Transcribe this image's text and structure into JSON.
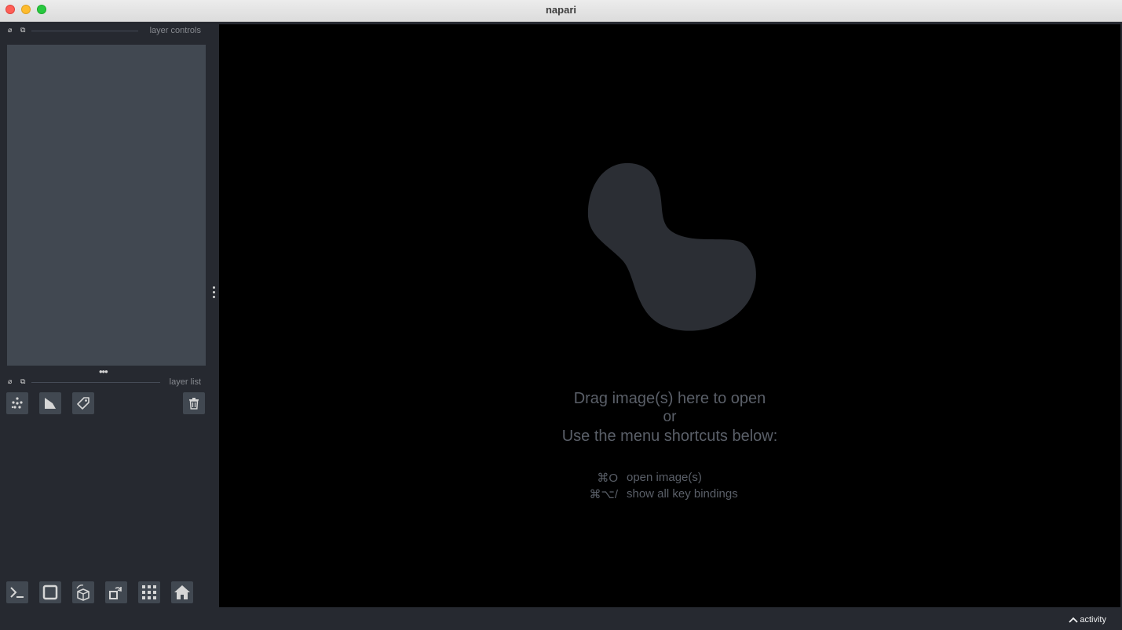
{
  "window": {
    "title": "napari"
  },
  "docks": {
    "layer_controls": {
      "label": "layer controls"
    },
    "layer_list": {
      "label": "layer list"
    }
  },
  "layer_buttons": {
    "new_points": "new-points-icon",
    "new_shapes": "new-shapes-icon",
    "new_labels": "new-labels-icon",
    "delete": "trash-icon"
  },
  "viewer_buttons": [
    "console-icon",
    "ndisplay-2d-icon",
    "roll-dims-icon",
    "transpose-dims-icon",
    "grid-view-icon",
    "home-icon"
  ],
  "welcome": {
    "line1": "Drag image(s) here to open",
    "line2": "or",
    "line3": "Use the menu shortcuts below:",
    "shortcuts": [
      {
        "key": "⌘O",
        "desc": "open image(s)"
      },
      {
        "key": "⌘⌥/",
        "desc": "show all key bindings"
      }
    ]
  },
  "status": {
    "activity_label": "activity"
  },
  "colors": {
    "background": "#262930",
    "panel": "#414851",
    "canvas": "#000000",
    "logo": "#2b2e34",
    "welcome_text": "#5a5f68"
  }
}
